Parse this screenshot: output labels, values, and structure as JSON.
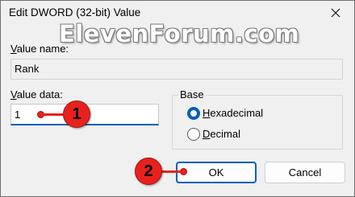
{
  "dialog": {
    "title": "Edit DWORD (32-bit) Value",
    "close_icon": "close-x-icon"
  },
  "watermark": {
    "text": "ElevenForum.com"
  },
  "value_name": {
    "label_accel": "V",
    "label_rest": "alue name:",
    "value": "Rank"
  },
  "value_data": {
    "label_accel": "V",
    "label_rest": "alue data:",
    "value": "1"
  },
  "base": {
    "legend": "Base",
    "options": [
      {
        "accel": "H",
        "rest": "exadecimal",
        "checked": true
      },
      {
        "accel": "D",
        "rest": "ecimal",
        "checked": false
      }
    ]
  },
  "buttons": {
    "ok": "OK",
    "cancel": "Cancel"
  },
  "markers": {
    "first": "1",
    "second": "2"
  },
  "colors": {
    "accent": "#005fb8",
    "marker": "#e8211d"
  }
}
